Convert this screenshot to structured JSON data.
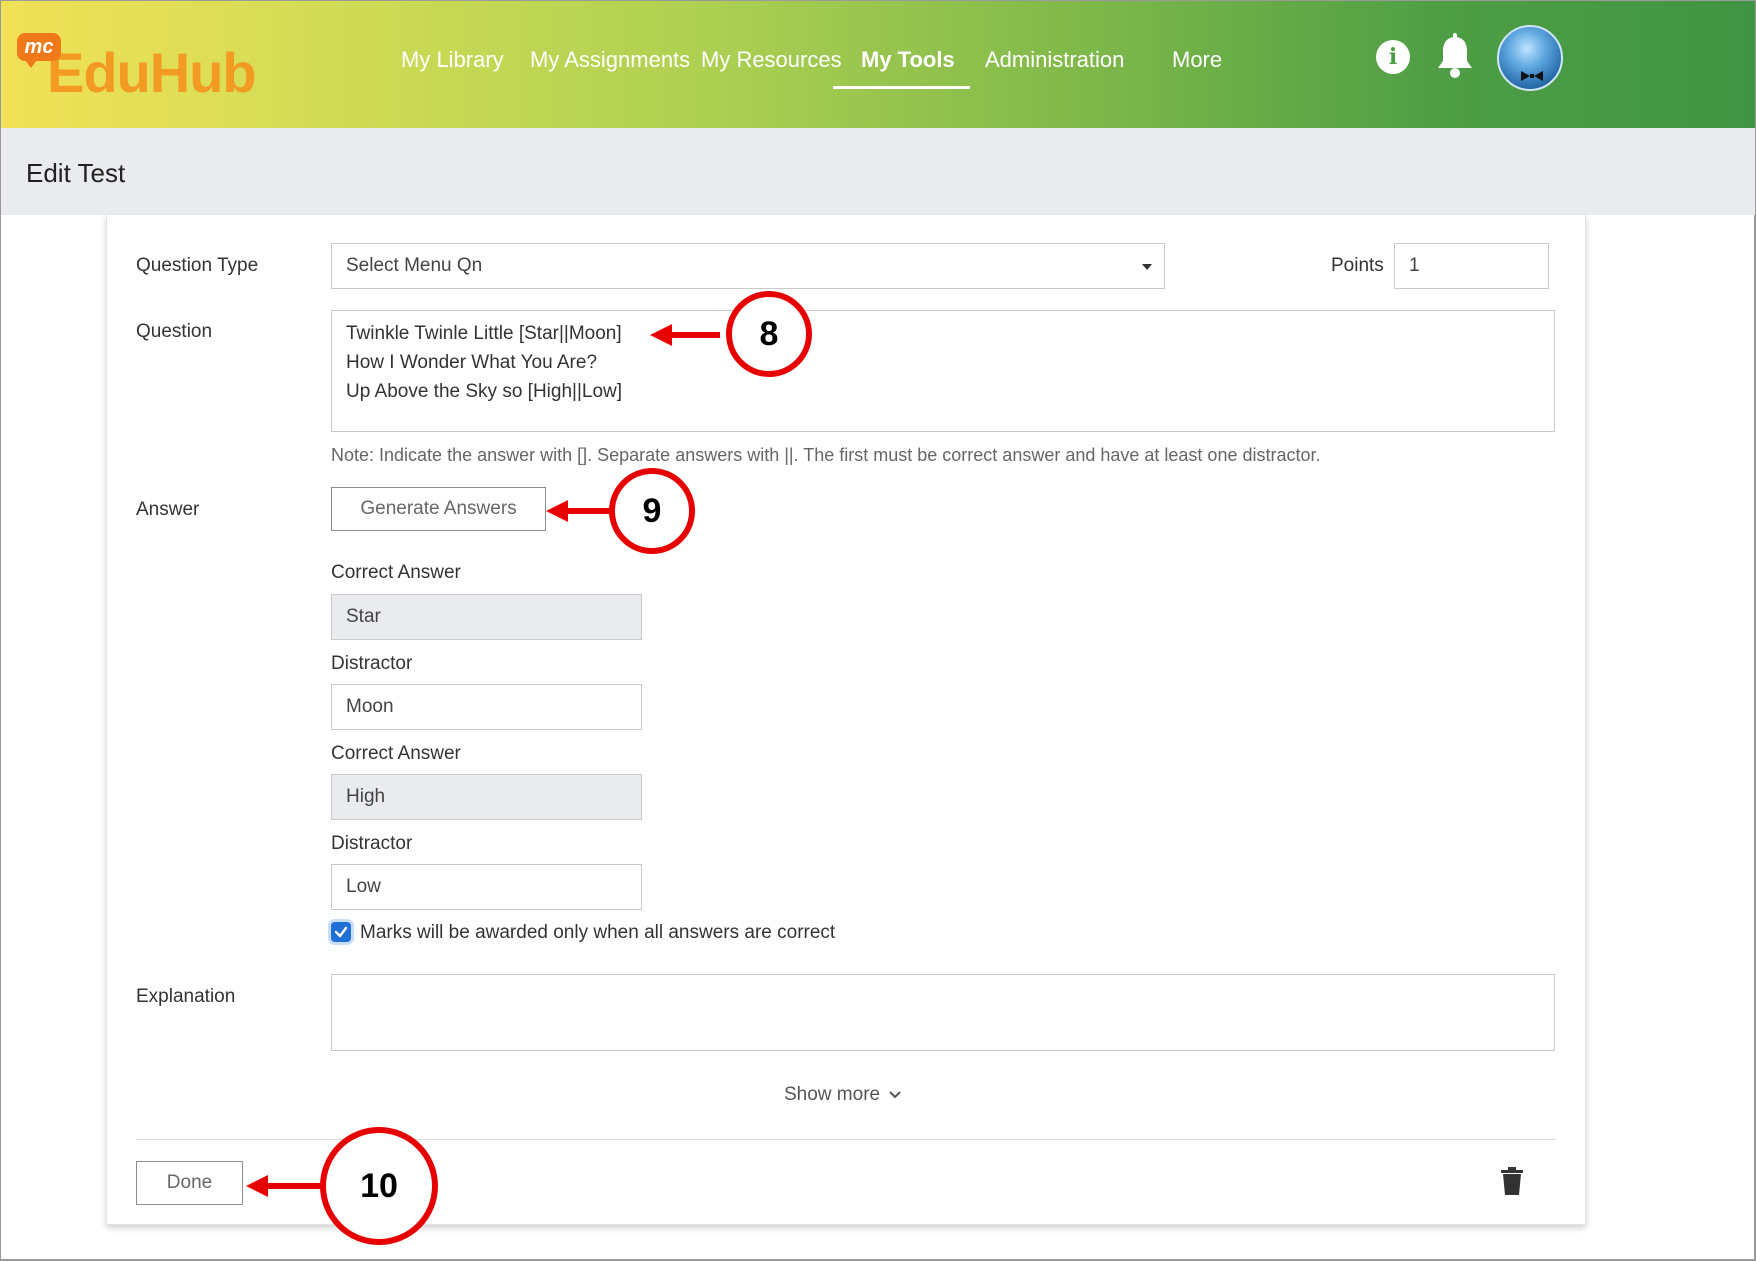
{
  "app": {
    "logo_badge": "mc",
    "logo_part1": "Edu",
    "logo_part2": "Hub"
  },
  "nav": {
    "items": [
      {
        "label": "My Library"
      },
      {
        "label": "My Assignments"
      },
      {
        "label": "My Resources"
      },
      {
        "label": "My Tools",
        "active": true
      },
      {
        "label": "Administration"
      },
      {
        "label": "More"
      }
    ]
  },
  "header_icons": {
    "info": "info-icon",
    "notifications": "bell-icon",
    "profile": "avatar"
  },
  "page": {
    "title": "Edit Test"
  },
  "form": {
    "question_type_label": "Question Type",
    "question_type_value": "Select Menu Qn",
    "points_label": "Points",
    "points_value": "1",
    "question_label": "Question",
    "question_lines": [
      "Twinkle Twinle Little [Star||Moon]",
      "How I Wonder What You Are?",
      "Up Above the Sky so [High||Low]"
    ],
    "note": "Note: Indicate the answer with []. Separate answers with ||. The first must be correct answer and have at least one distractor.",
    "answer_label": "Answer",
    "generate_button": "Generate Answers",
    "answers": [
      {
        "label": "Correct Answer",
        "value": "Star"
      },
      {
        "label": "Distractor",
        "value": "Moon"
      },
      {
        "label": "Correct Answer",
        "value": "High"
      },
      {
        "label": "Distractor",
        "value": "Low"
      }
    ],
    "all_correct_checkbox_label": "Marks will be awarded only when all answers are correct",
    "all_correct_checked": true,
    "explanation_label": "Explanation",
    "explanation_value": "",
    "show_more": "Show more",
    "done_button": "Done"
  },
  "annotations": {
    "markers": [
      "8",
      "9",
      "10"
    ],
    "color": "#e60000"
  },
  "colors": {
    "header_start": "#f1e157",
    "header_end": "#3f9443",
    "checkbox": "#1f6fd6",
    "subheader_bg": "#e9ebee"
  }
}
